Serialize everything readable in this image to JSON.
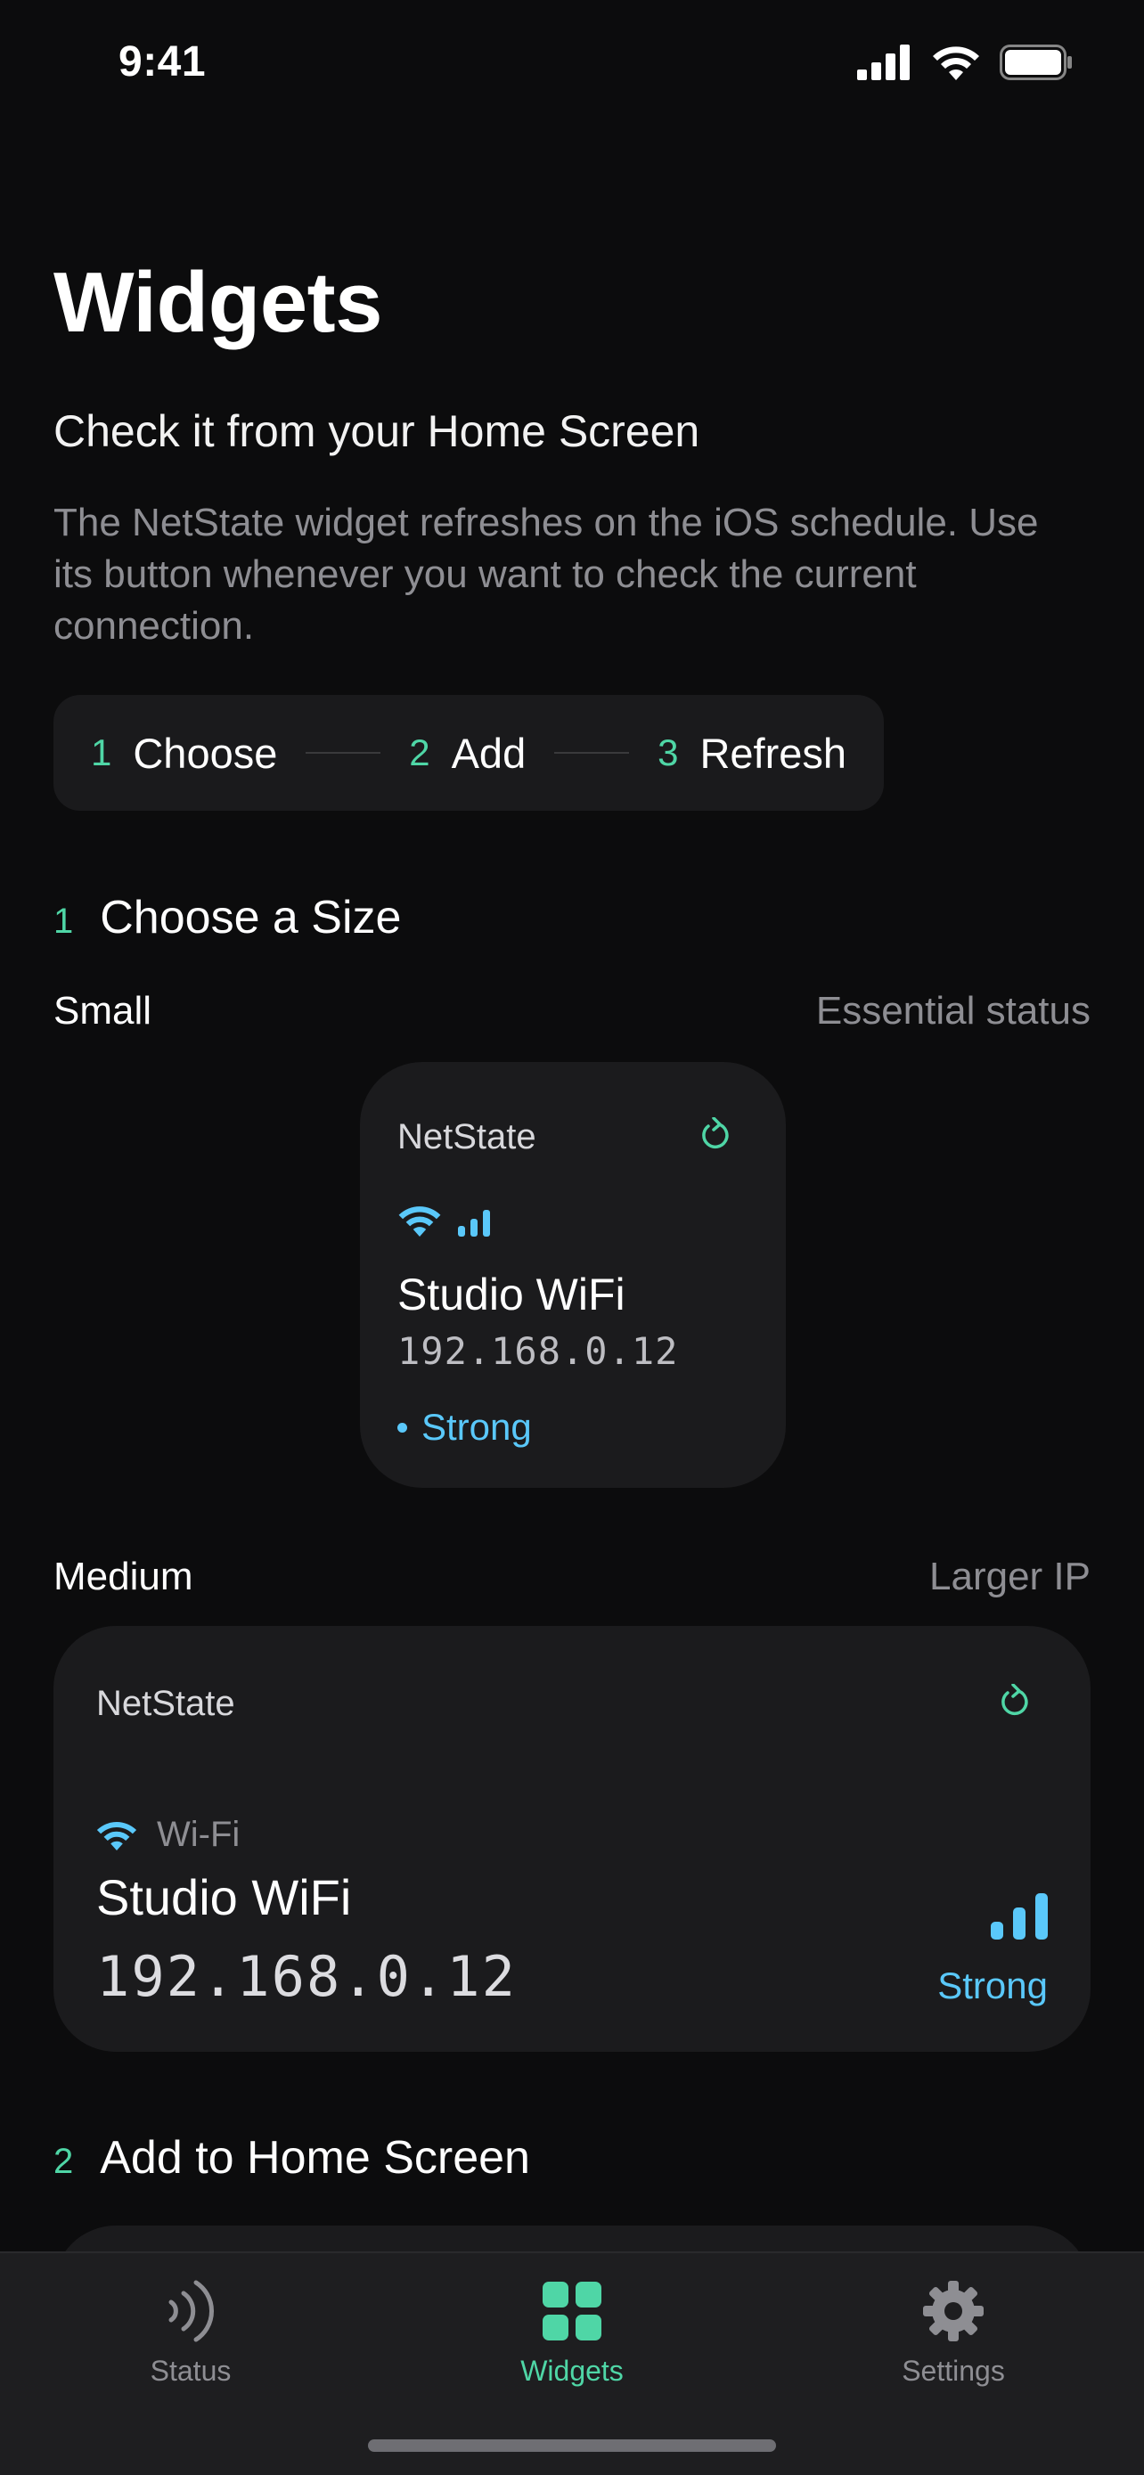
{
  "status_bar": {
    "time": "9:41"
  },
  "header": {
    "title": "Widgets",
    "subtitle": "Check it from your Home Screen",
    "description": "The NetState widget refreshes on the iOS schedule. Use its button whenever you want to check the current connection."
  },
  "steps": [
    {
      "num": "1",
      "label": "Choose"
    },
    {
      "num": "2",
      "label": "Add"
    },
    {
      "num": "3",
      "label": "Refresh"
    }
  ],
  "section_choose": {
    "num": "1",
    "title": "Choose a Size"
  },
  "small_row": {
    "label": "Small",
    "caption": "Essential status"
  },
  "small_widget": {
    "app_name": "NetState",
    "ssid": "Studio WiFi",
    "ip": "192.168.0.12",
    "strength": "Strong"
  },
  "medium_row": {
    "label": "Medium",
    "caption": "Larger IP"
  },
  "medium_widget": {
    "app_name": "NetState",
    "connection_type": "Wi-Fi",
    "ssid": "Studio WiFi",
    "ip": "192.168.0.12",
    "strength": "Strong"
  },
  "section_add": {
    "num": "2",
    "title": "Add to Home Screen"
  },
  "tab_bar": {
    "tabs": [
      {
        "label": "Status",
        "icon": "signal-waves-icon",
        "active": false
      },
      {
        "label": "Widgets",
        "icon": "grid-icon",
        "active": true
      },
      {
        "label": "Settings",
        "icon": "gear-icon",
        "active": false
      }
    ]
  },
  "colors": {
    "accent_green": "#4fd6a6",
    "accent_blue": "#5ac8fa",
    "background": "#0c0c0d",
    "card": "#1b1b1d"
  }
}
